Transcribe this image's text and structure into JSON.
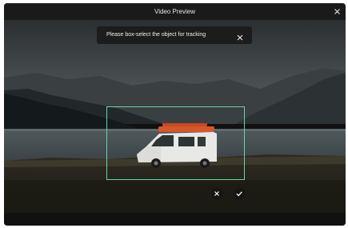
{
  "window": {
    "title": "Video Preview",
    "close_icon": "close-icon"
  },
  "toast": {
    "message": "Please box-select the object for tracking",
    "close_icon": "close-icon"
  },
  "actions": {
    "cancel_icon": "close-icon",
    "confirm_icon": "check-icon"
  },
  "colors": {
    "selection_border": "#67d6a0",
    "window_bg": "#111111",
    "toast_bg": "#1c1c1c"
  }
}
